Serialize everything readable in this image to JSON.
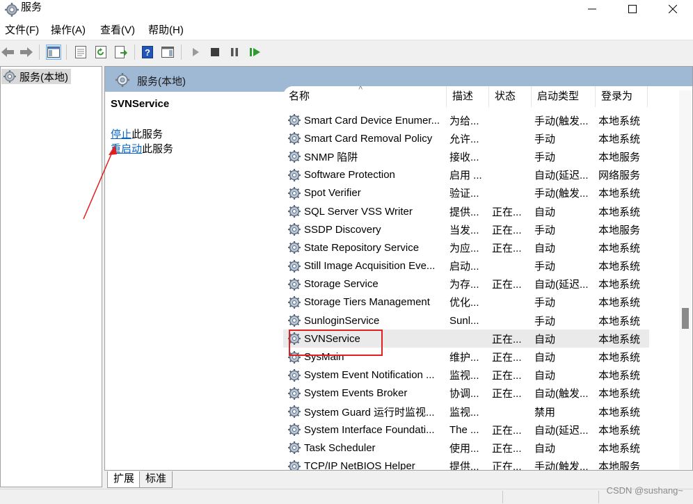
{
  "window": {
    "title": "服务",
    "controls": {
      "minimize": "—",
      "maximize": "☐",
      "close": "✕"
    }
  },
  "menu": [
    "文件(F)",
    "操作(A)",
    "查看(V)",
    "帮助(H)"
  ],
  "toolbar": {
    "icons": [
      "back-icon",
      "forward-icon",
      "show-hide-console-tree-icon",
      "properties-icon",
      "refresh-icon",
      "export-list-icon",
      "help-icon",
      "action-pane-icon",
      "start-service-icon",
      "stop-service-icon",
      "pause-service-icon",
      "restart-service-icon"
    ]
  },
  "tree": {
    "item": "服务(本地)"
  },
  "right_header": {
    "title": "服务(本地)"
  },
  "detail": {
    "service_name": "SVNService",
    "stop_link": "停止",
    "stop_suffix": "此服务",
    "restart_link": "重启动",
    "restart_suffix": "此服务"
  },
  "columns": {
    "name": "名称",
    "desc": "描述",
    "status": "状态",
    "startup": "启动类型",
    "logon": "登录为"
  },
  "rows": [
    {
      "name": "Smart Card Device Enumer...",
      "desc": "为给...",
      "status": "",
      "startup": "手动(触发...",
      "logon": "本地系统"
    },
    {
      "name": "Smart Card Removal Policy",
      "desc": "允许...",
      "status": "",
      "startup": "手动",
      "logon": "本地系统"
    },
    {
      "name": "SNMP 陷阱",
      "desc": "接收...",
      "status": "",
      "startup": "手动",
      "logon": "本地服务"
    },
    {
      "name": "Software Protection",
      "desc": "启用 ...",
      "status": "",
      "startup": "自动(延迟...",
      "logon": "网络服务"
    },
    {
      "name": "Spot Verifier",
      "desc": "验证...",
      "status": "",
      "startup": "手动(触发...",
      "logon": "本地系统"
    },
    {
      "name": "SQL Server VSS Writer",
      "desc": "提供...",
      "status": "正在...",
      "startup": "自动",
      "logon": "本地系统"
    },
    {
      "name": "SSDP Discovery",
      "desc": "当发...",
      "status": "正在...",
      "startup": "手动",
      "logon": "本地服务"
    },
    {
      "name": "State Repository Service",
      "desc": "为应...",
      "status": "正在...",
      "startup": "自动",
      "logon": "本地系统"
    },
    {
      "name": "Still Image Acquisition Eve...",
      "desc": "启动...",
      "status": "",
      "startup": "手动",
      "logon": "本地系统"
    },
    {
      "name": "Storage Service",
      "desc": "为存...",
      "status": "正在...",
      "startup": "自动(延迟...",
      "logon": "本地系统"
    },
    {
      "name": "Storage Tiers Management",
      "desc": "优化...",
      "status": "",
      "startup": "手动",
      "logon": "本地系统"
    },
    {
      "name": "SunloginService",
      "desc": "Sunl...",
      "status": "",
      "startup": "手动",
      "logon": "本地系统"
    },
    {
      "name": "SVNService",
      "desc": "",
      "status": "正在...",
      "startup": "自动",
      "logon": "本地系统",
      "selected": true
    },
    {
      "name": "SysMain",
      "desc": "维护...",
      "status": "正在...",
      "startup": "自动",
      "logon": "本地系统"
    },
    {
      "name": "System Event Notification ...",
      "desc": "监视...",
      "status": "正在...",
      "startup": "自动",
      "logon": "本地系统"
    },
    {
      "name": "System Events Broker",
      "desc": "协调...",
      "status": "正在...",
      "startup": "自动(触发...",
      "logon": "本地系统"
    },
    {
      "name": "System Guard 运行时监视...",
      "desc": "监视...",
      "status": "",
      "startup": "禁用",
      "logon": "本地系统"
    },
    {
      "name": "System Interface Foundati...",
      "desc": "The ...",
      "status": "正在...",
      "startup": "自动(延迟...",
      "logon": "本地系统"
    },
    {
      "name": "Task Scheduler",
      "desc": "使用...",
      "status": "正在...",
      "startup": "自动",
      "logon": "本地系统"
    },
    {
      "name": "TCP/IP NetBIOS Helper",
      "desc": "提供...",
      "status": "正在...",
      "startup": "手动(触发...",
      "logon": "本地服务"
    }
  ],
  "tabs": [
    "扩展",
    "标准"
  ],
  "watermark": "CSDN @sushang~",
  "colors": {
    "header_bar": "#9fb8d4",
    "link": "#0563c1",
    "highlight_box": "#e02020",
    "selected_row": "#eaeaea"
  }
}
